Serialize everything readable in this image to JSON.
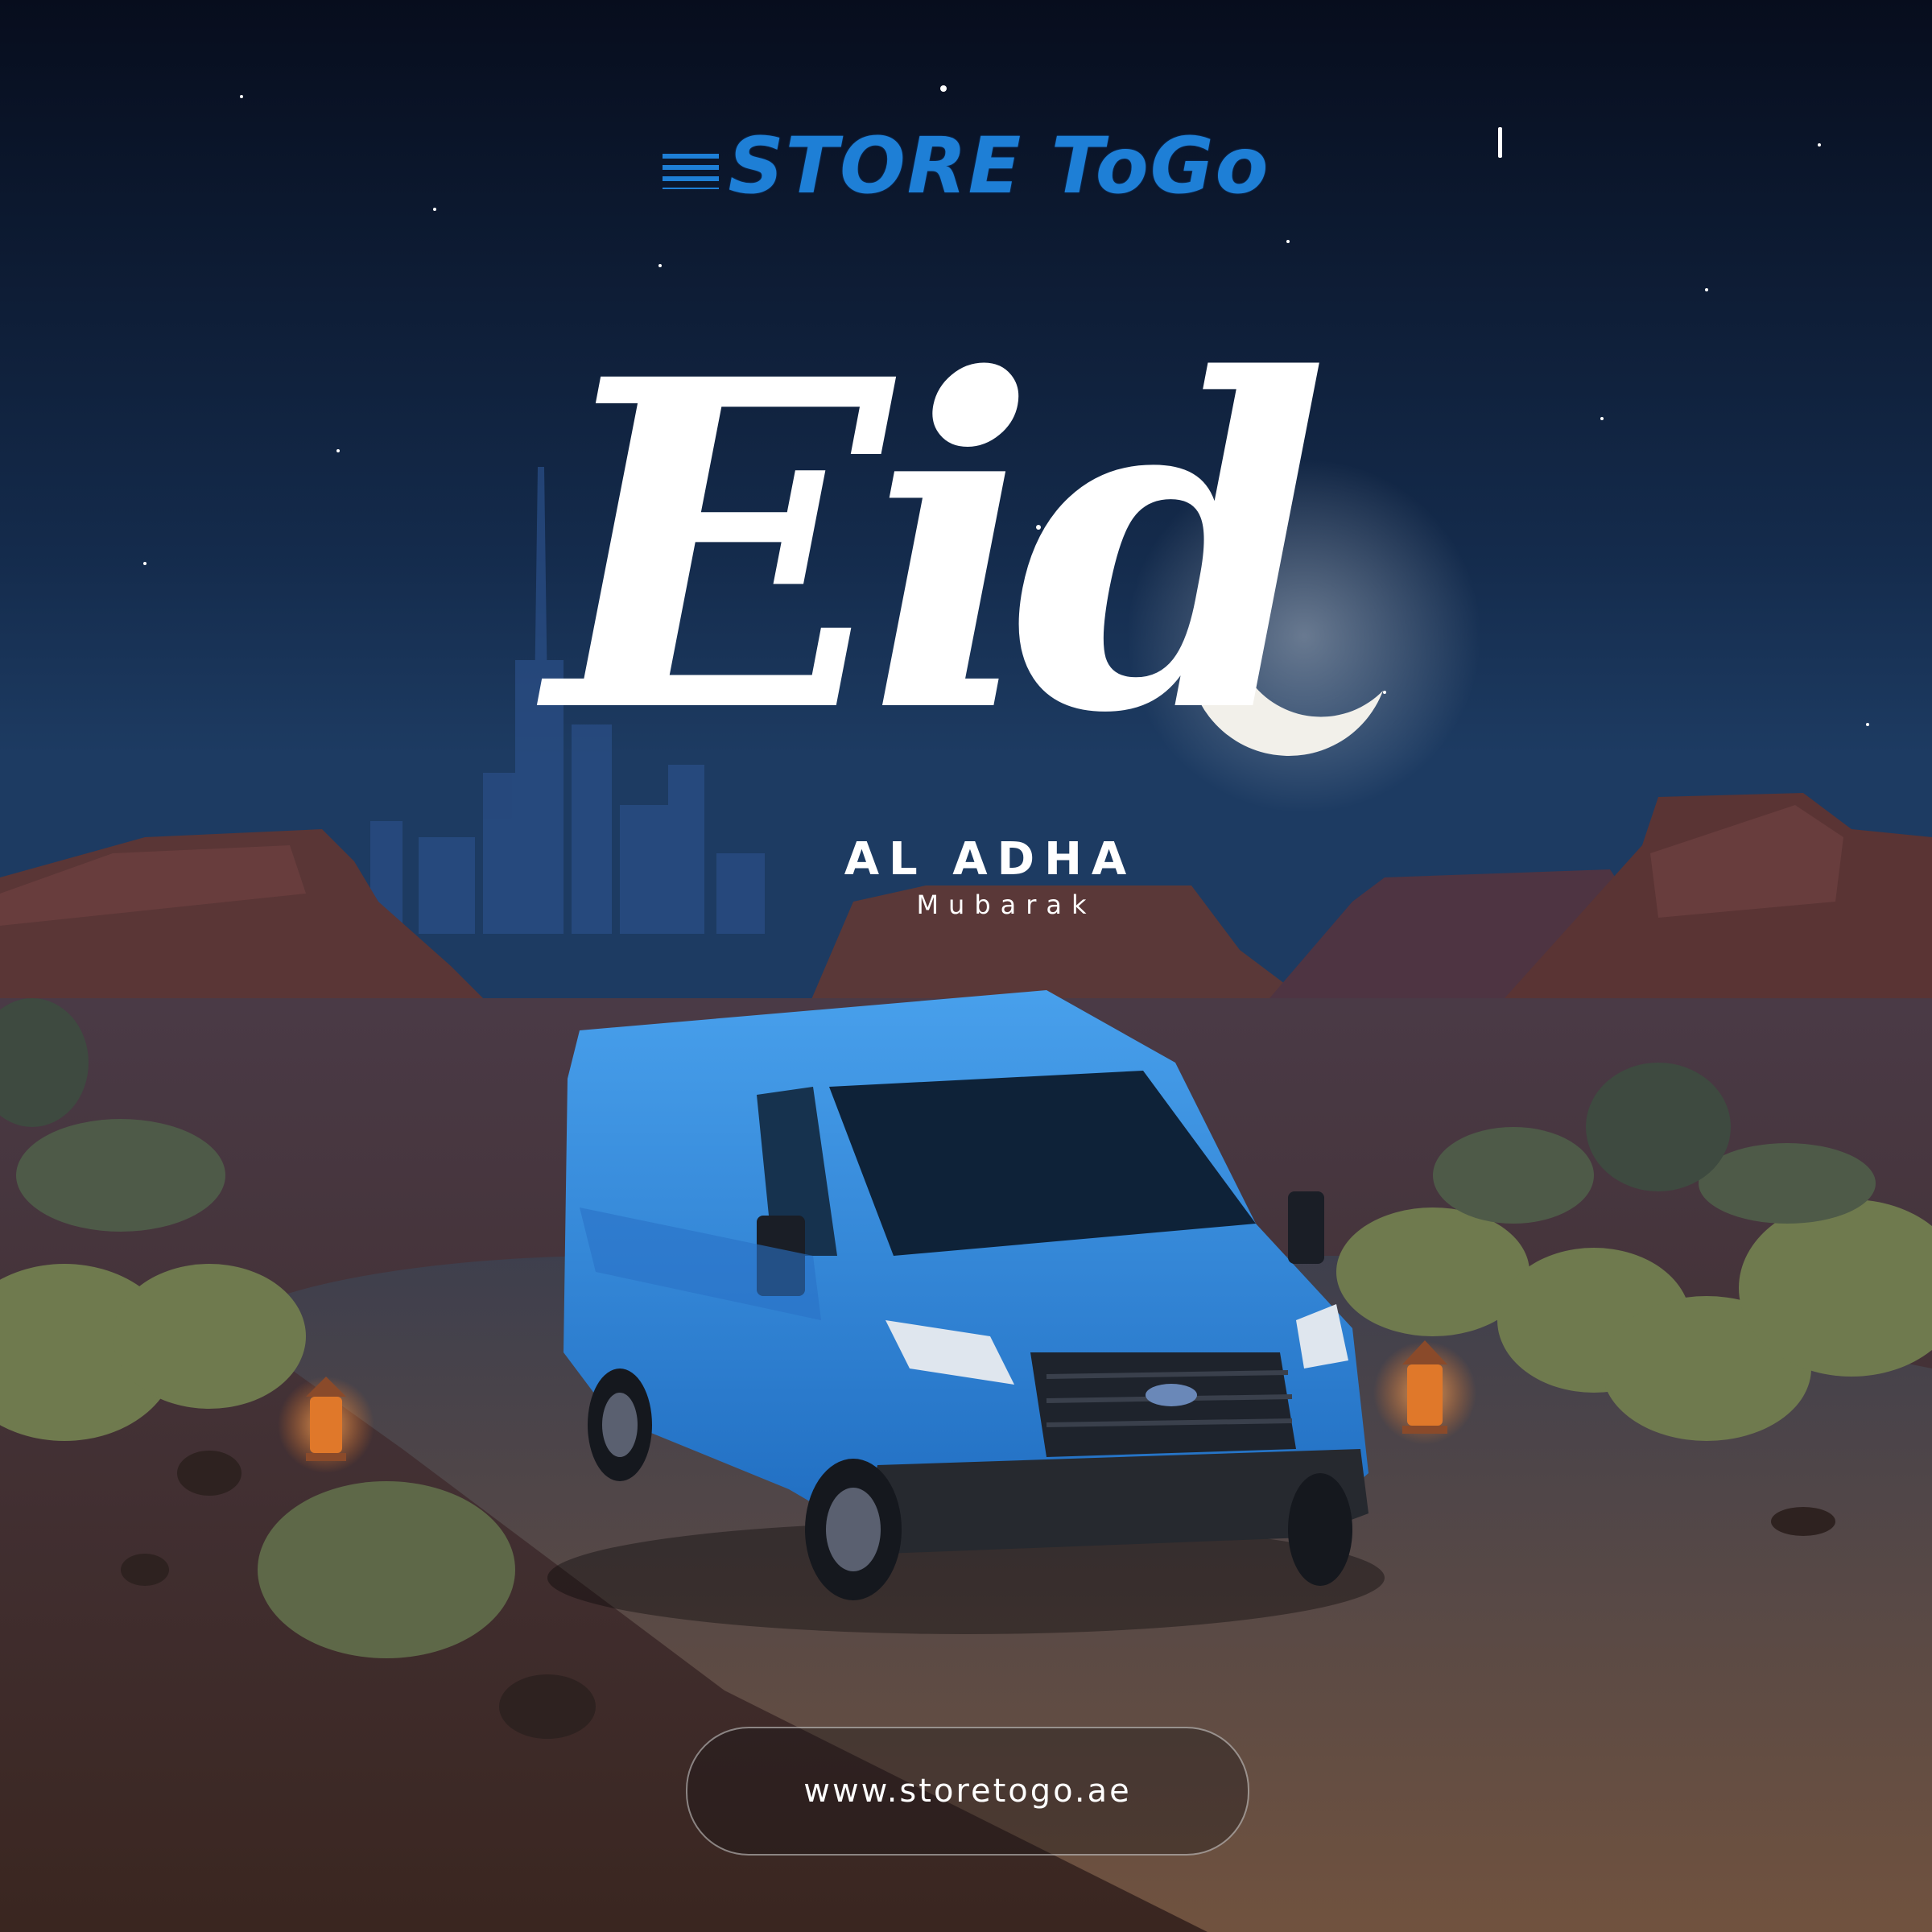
{
  "brand": {
    "logo_text": "STORE ToGo"
  },
  "headline": {
    "eid": "Eid",
    "subtitle": "AL ADHA",
    "tagline": "Mubarak"
  },
  "footer": {
    "url": "www.storetogo.ae"
  },
  "colors": {
    "sky_top": "#070d1d",
    "sky_bottom": "#1d3b62",
    "brand_blue": "#1e7fd6",
    "van_blue": "#2e86d6",
    "sand": "#6a4a3a",
    "mesa": "#5a3636"
  },
  "scene": {
    "elements": [
      "night-sky",
      "stars",
      "crescent-moon",
      "city-skyline",
      "desert-mesas",
      "road",
      "blue-van",
      "lanterns",
      "desert-shrubs"
    ]
  }
}
